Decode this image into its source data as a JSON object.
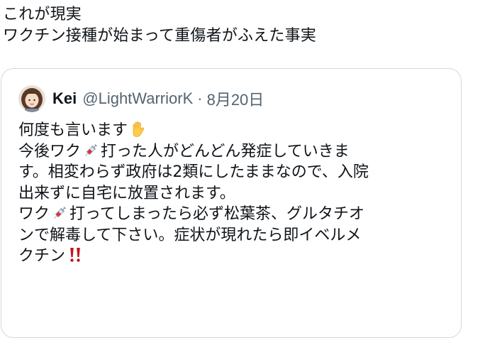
{
  "tweet": {
    "lines": [
      "これが現実",
      "ワクチン接種が始まって重傷者がふえた事実"
    ]
  },
  "quote": {
    "author": {
      "name": "Kei",
      "handle": "@LightWarriorK",
      "separator": "·",
      "date": "8月20日"
    },
    "body": {
      "l1": "何度も言います",
      "l2a": "今後ワク",
      "l2b": "打った人がどんどん発症していきま",
      "l3": "す。相変わらず政府は2類にしたままなので、入院",
      "l4": "出来ずに自宅に放置されます。",
      "l5a": "ワク",
      "l5b": "打ってしまったら必ず松葉茶、グルタチオ",
      "l6": "ンで解毒して下さい。症状が現れたら即イベルメ",
      "l7": "クチン"
    },
    "emojis": {
      "hand": "raised-hand-icon",
      "syringe": "syringe-icon",
      "exclaim": "double-exclamation-icon"
    }
  },
  "colors": {
    "text": "#0f1419",
    "secondary": "#536471",
    "border": "#cfd9de",
    "exclaim": "#c1121f"
  }
}
